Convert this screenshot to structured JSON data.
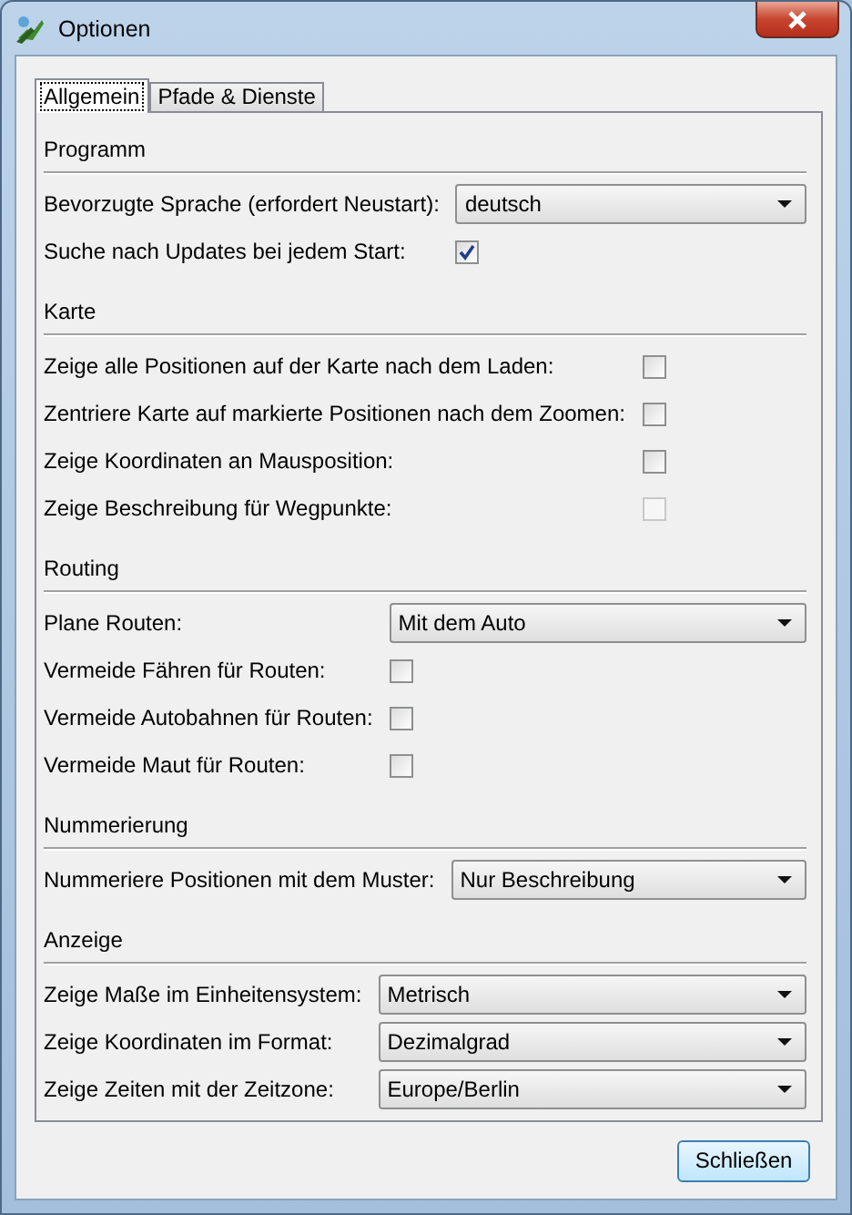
{
  "window": {
    "title": "Optionen"
  },
  "tabs": [
    {
      "label": "Allgemein",
      "selected": true
    },
    {
      "label": "Pfade & Dienste",
      "selected": false
    }
  ],
  "sections": [
    {
      "title": "Programm",
      "rows": [
        {
          "kind": "select",
          "label": "Bevorzugte Sprache (erfordert Neustart):",
          "value": "deutsch"
        },
        {
          "kind": "checkbox",
          "label": "Suche nach Updates bei jedem Start:",
          "checked": true,
          "disabled": false
        }
      ]
    },
    {
      "title": "Karte",
      "rows": [
        {
          "kind": "checkbox",
          "label": "Zeige alle Positionen auf der Karte nach dem Laden:",
          "checked": false,
          "disabled": false
        },
        {
          "kind": "checkbox",
          "label": "Zentriere Karte auf markierte Positionen nach dem Zoomen:",
          "checked": false,
          "disabled": false
        },
        {
          "kind": "checkbox",
          "label": "Zeige Koordinaten an Mausposition:",
          "checked": false,
          "disabled": false
        },
        {
          "kind": "checkbox",
          "label": "Zeige Beschreibung für Wegpunkte:",
          "checked": false,
          "disabled": true
        }
      ]
    },
    {
      "title": "Routing",
      "rows": [
        {
          "kind": "select",
          "label": "Plane Routen:",
          "value": "Mit dem Auto"
        },
        {
          "kind": "checkbox",
          "label": "Vermeide Fähren für Routen:",
          "checked": false,
          "disabled": false
        },
        {
          "kind": "checkbox",
          "label": "Vermeide Autobahnen für Routen:",
          "checked": false,
          "disabled": false
        },
        {
          "kind": "checkbox",
          "label": "Vermeide Maut für Routen:",
          "checked": false,
          "disabled": false
        }
      ]
    },
    {
      "title": "Nummerierung",
      "rows": [
        {
          "kind": "select",
          "label": "Nummeriere Positionen mit dem Muster:",
          "value": "Nur Beschreibung"
        }
      ]
    },
    {
      "title": "Anzeige",
      "rows": [
        {
          "kind": "select",
          "label": "Zeige Maße im Einheitensystem:",
          "value": "Metrisch"
        },
        {
          "kind": "select",
          "label": "Zeige Koordinaten im Format:",
          "value": "Dezimalgrad"
        },
        {
          "kind": "select",
          "label": "Zeige Zeiten mit der Zeitzone:",
          "value": "Europe/Berlin"
        }
      ]
    }
  ],
  "close_button": "Schließen"
}
